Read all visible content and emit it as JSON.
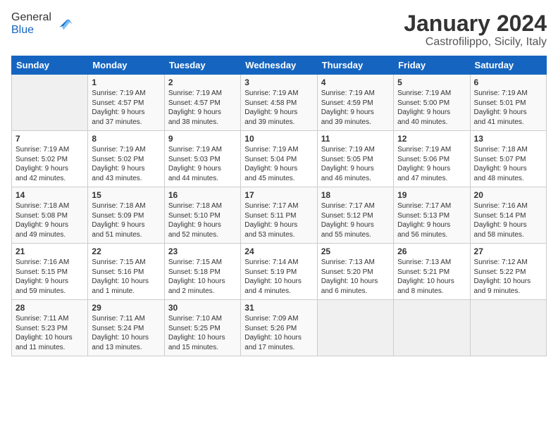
{
  "header": {
    "logo_line1": "General",
    "logo_line2": "Blue",
    "title": "January 2024",
    "subtitle": "Castrofilippo, Sicily, Italy"
  },
  "days_of_week": [
    "Sunday",
    "Monday",
    "Tuesday",
    "Wednesday",
    "Thursday",
    "Friday",
    "Saturday"
  ],
  "weeks": [
    [
      {
        "day": "",
        "info": ""
      },
      {
        "day": "1",
        "info": "Sunrise: 7:19 AM\nSunset: 4:57 PM\nDaylight: 9 hours\nand 37 minutes."
      },
      {
        "day": "2",
        "info": "Sunrise: 7:19 AM\nSunset: 4:57 PM\nDaylight: 9 hours\nand 38 minutes."
      },
      {
        "day": "3",
        "info": "Sunrise: 7:19 AM\nSunset: 4:58 PM\nDaylight: 9 hours\nand 39 minutes."
      },
      {
        "day": "4",
        "info": "Sunrise: 7:19 AM\nSunset: 4:59 PM\nDaylight: 9 hours\nand 39 minutes."
      },
      {
        "day": "5",
        "info": "Sunrise: 7:19 AM\nSunset: 5:00 PM\nDaylight: 9 hours\nand 40 minutes."
      },
      {
        "day": "6",
        "info": "Sunrise: 7:19 AM\nSunset: 5:01 PM\nDaylight: 9 hours\nand 41 minutes."
      }
    ],
    [
      {
        "day": "7",
        "info": "Sunrise: 7:19 AM\nSunset: 5:02 PM\nDaylight: 9 hours\nand 42 minutes."
      },
      {
        "day": "8",
        "info": "Sunrise: 7:19 AM\nSunset: 5:02 PM\nDaylight: 9 hours\nand 43 minutes."
      },
      {
        "day": "9",
        "info": "Sunrise: 7:19 AM\nSunset: 5:03 PM\nDaylight: 9 hours\nand 44 minutes."
      },
      {
        "day": "10",
        "info": "Sunrise: 7:19 AM\nSunset: 5:04 PM\nDaylight: 9 hours\nand 45 minutes."
      },
      {
        "day": "11",
        "info": "Sunrise: 7:19 AM\nSunset: 5:05 PM\nDaylight: 9 hours\nand 46 minutes."
      },
      {
        "day": "12",
        "info": "Sunrise: 7:19 AM\nSunset: 5:06 PM\nDaylight: 9 hours\nand 47 minutes."
      },
      {
        "day": "13",
        "info": "Sunrise: 7:18 AM\nSunset: 5:07 PM\nDaylight: 9 hours\nand 48 minutes."
      }
    ],
    [
      {
        "day": "14",
        "info": "Sunrise: 7:18 AM\nSunset: 5:08 PM\nDaylight: 9 hours\nand 49 minutes."
      },
      {
        "day": "15",
        "info": "Sunrise: 7:18 AM\nSunset: 5:09 PM\nDaylight: 9 hours\nand 51 minutes."
      },
      {
        "day": "16",
        "info": "Sunrise: 7:18 AM\nSunset: 5:10 PM\nDaylight: 9 hours\nand 52 minutes."
      },
      {
        "day": "17",
        "info": "Sunrise: 7:17 AM\nSunset: 5:11 PM\nDaylight: 9 hours\nand 53 minutes."
      },
      {
        "day": "18",
        "info": "Sunrise: 7:17 AM\nSunset: 5:12 PM\nDaylight: 9 hours\nand 55 minutes."
      },
      {
        "day": "19",
        "info": "Sunrise: 7:17 AM\nSunset: 5:13 PM\nDaylight: 9 hours\nand 56 minutes."
      },
      {
        "day": "20",
        "info": "Sunrise: 7:16 AM\nSunset: 5:14 PM\nDaylight: 9 hours\nand 58 minutes."
      }
    ],
    [
      {
        "day": "21",
        "info": "Sunrise: 7:16 AM\nSunset: 5:15 PM\nDaylight: 9 hours\nand 59 minutes."
      },
      {
        "day": "22",
        "info": "Sunrise: 7:15 AM\nSunset: 5:16 PM\nDaylight: 10 hours\nand 1 minute."
      },
      {
        "day": "23",
        "info": "Sunrise: 7:15 AM\nSunset: 5:18 PM\nDaylight: 10 hours\nand 2 minutes."
      },
      {
        "day": "24",
        "info": "Sunrise: 7:14 AM\nSunset: 5:19 PM\nDaylight: 10 hours\nand 4 minutes."
      },
      {
        "day": "25",
        "info": "Sunrise: 7:13 AM\nSunset: 5:20 PM\nDaylight: 10 hours\nand 6 minutes."
      },
      {
        "day": "26",
        "info": "Sunrise: 7:13 AM\nSunset: 5:21 PM\nDaylight: 10 hours\nand 8 minutes."
      },
      {
        "day": "27",
        "info": "Sunrise: 7:12 AM\nSunset: 5:22 PM\nDaylight: 10 hours\nand 9 minutes."
      }
    ],
    [
      {
        "day": "28",
        "info": "Sunrise: 7:11 AM\nSunset: 5:23 PM\nDaylight: 10 hours\nand 11 minutes."
      },
      {
        "day": "29",
        "info": "Sunrise: 7:11 AM\nSunset: 5:24 PM\nDaylight: 10 hours\nand 13 minutes."
      },
      {
        "day": "30",
        "info": "Sunrise: 7:10 AM\nSunset: 5:25 PM\nDaylight: 10 hours\nand 15 minutes."
      },
      {
        "day": "31",
        "info": "Sunrise: 7:09 AM\nSunset: 5:26 PM\nDaylight: 10 hours\nand 17 minutes."
      },
      {
        "day": "",
        "info": ""
      },
      {
        "day": "",
        "info": ""
      },
      {
        "day": "",
        "info": ""
      }
    ]
  ]
}
